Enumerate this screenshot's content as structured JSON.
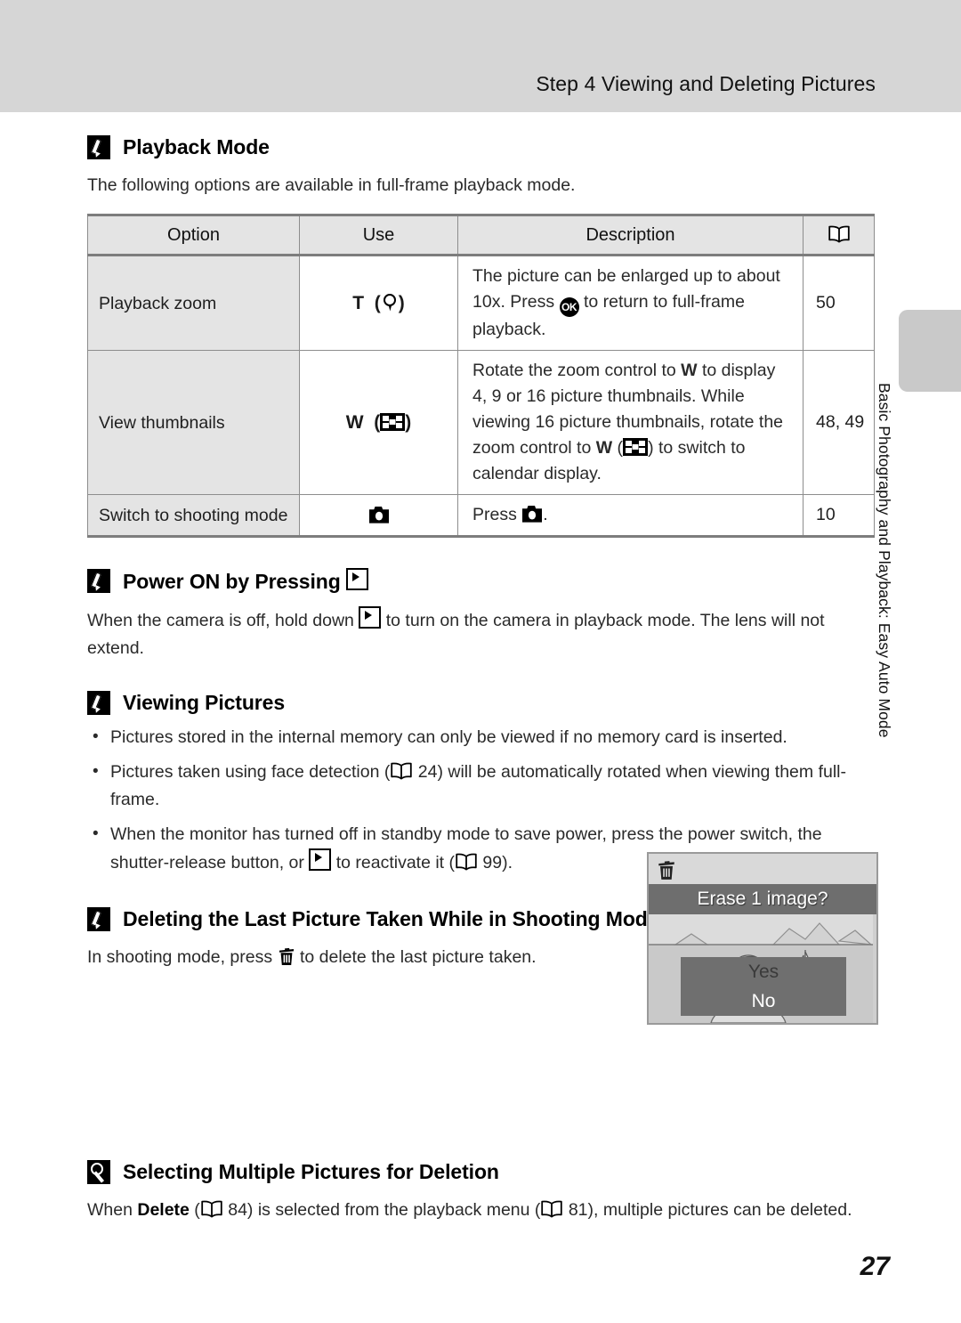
{
  "header": {
    "title": "Step 4 Viewing and Deleting Pictures"
  },
  "side_tab": {
    "label": "Basic Photography and Playback: Easy Auto Mode"
  },
  "page_number": "27",
  "sections": {
    "playback_mode": {
      "icon": "note-icon",
      "heading": "Playback Mode",
      "intro": "The following options are available in full-frame playback mode.",
      "table": {
        "headers": {
          "option": "Option",
          "use": "Use",
          "description": "Description",
          "page_ref_icon": "book-icon"
        },
        "rows": [
          {
            "option": "Playback zoom",
            "use_label": "T",
            "use_icon": "magnifier-icon",
            "description_parts": [
              "The picture can be enlarged up to about 10x. Press ",
              "ok-button-icon",
              " to return to full-frame playback."
            ],
            "description_text": "The picture can be enlarged up to about 10x. Press (OK) to return to full-frame playback.",
            "page": "50"
          },
          {
            "option": "View thumbnails",
            "use_label": "W",
            "use_icon": "thumbnails-icon",
            "description_text": "Rotate the zoom control to W to display 4, 9 or 16 picture thumbnails. While viewing 16 picture thumbnails, rotate the zoom control to W (thumbnails) to switch to calendar display.",
            "description_line1_a": "Rotate the zoom control to ",
            "description_line1_b": " to display 4, 9 or 16 picture thumbnails.",
            "description_line2_a": "While viewing 16 picture thumbnails, rotate the zoom control to ",
            "description_line2_b": " (",
            "description_line2_c": ") to switch to calendar display.",
            "zoom_w_label": "W",
            "page": "48, 49"
          },
          {
            "option": "Switch to shooting mode",
            "use_label": "",
            "use_icon": "camera-icon",
            "description_prefix": "Press ",
            "description_suffix": ".",
            "description_text": "Press (camera).",
            "page": "10"
          }
        ]
      }
    },
    "power_on": {
      "icon": "note-icon",
      "heading_text": "Power ON by Pressing ",
      "heading_icon": "playback-button-icon",
      "body_a": "When the camera is off, hold down ",
      "body_b": " to turn on the camera in playback mode. The lens will not extend.",
      "body_text": "When the camera is off, hold down (playback) to turn on the camera in playback mode. The lens will not extend."
    },
    "viewing_pictures": {
      "icon": "note-icon",
      "heading": "Viewing Pictures",
      "bullets": [
        {
          "text": "Pictures stored in the internal memory can only be viewed if no memory card is inserted."
        },
        {
          "part_a": "Pictures taken using face detection (",
          "ref_icon": "book-icon",
          "ref_page": " 24",
          "part_b": ") will be automatically rotated when viewing them full-frame.",
          "text": "Pictures taken using face detection (book 24) will be automatically rotated when viewing them full-frame."
        },
        {
          "part_a": "When the monitor has turned off in standby mode to save power, press the power switch, the shutter-release button, or ",
          "icon": "playback-button-icon",
          "part_b": " to reactivate it (",
          "ref_icon": "book-icon",
          "ref_page": " 99",
          "part_c": ").",
          "text": "When the monitor has turned off in standby mode to save power, press the power switch, the shutter-release button, or (playback) to reactivate it (book 99)."
        }
      ]
    },
    "deleting_last": {
      "icon": "note-icon",
      "heading": "Deleting the Last Picture Taken While in Shooting Mode",
      "body_a": "In shooting mode, press ",
      "body_icon": "trash-icon",
      "body_b": " to delete the last picture taken.",
      "body_text": "In shooting mode, press (trash) to delete the last picture taken.",
      "screen": {
        "trash_icon": "trash-icon",
        "banner": "Erase 1 image?",
        "options": [
          {
            "label": "Yes",
            "selected": false
          },
          {
            "label": "No",
            "selected": true
          }
        ]
      }
    },
    "selecting_multiple": {
      "icon": "tip-icon",
      "heading": "Selecting Multiple Pictures for Deletion",
      "body_a": "When ",
      "body_bold": "Delete",
      "body_b": " (",
      "ref_icon_1": "book-icon",
      "ref_page_1": " 84",
      "body_c": ") is selected from the playback menu (",
      "ref_icon_2": "book-icon",
      "ref_page_2": " 81",
      "body_d": "), multiple pictures can be deleted.",
      "body_text": "When Delete (book 84) is selected from the playback menu (book 81), multiple pictures can be deleted."
    }
  },
  "colors": {
    "header_band": "#d6d6d6",
    "table_header": "#e4e4e4",
    "rule": "#7d7d7d",
    "screen_banner": "#6e6e6e"
  }
}
